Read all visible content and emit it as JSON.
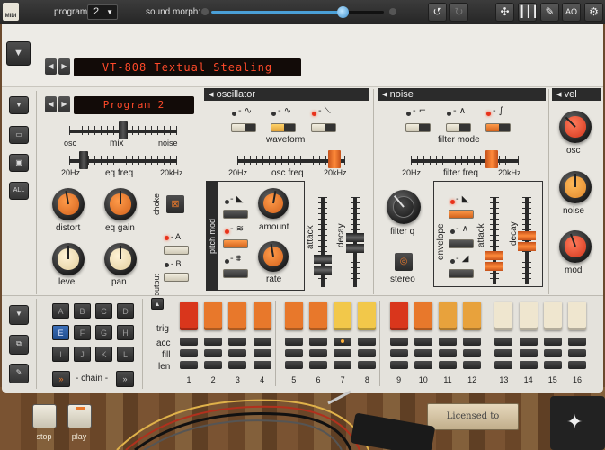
{
  "topbar": {
    "midi_badge": "MIDI",
    "program_label": "program:",
    "program_value": "2",
    "morph_label": "sound morph:",
    "morph_value": 0.76,
    "buttons": [
      "undo-icon",
      "redo-icon",
      "grid-icon",
      "mixer-icon",
      "edit-icon",
      "ab-icon",
      "gear-icon"
    ],
    "ab_label": "Aʘ"
  },
  "header": {
    "preset_name": "VT-808 Textual Stealing",
    "program_name": "Program 2"
  },
  "side": {
    "all_label": "ALL"
  },
  "left_section": {
    "mix": {
      "label": "mix",
      "left": "osc",
      "right": "noise",
      "value": 0.5
    },
    "eq_freq": {
      "label": "eq freq",
      "left": "20Hz",
      "right": "20kHz",
      "value": 0.1
    },
    "knobs": [
      {
        "label": "distort",
        "value": 0.55
      },
      {
        "label": "eq gain",
        "value": 0.5
      },
      {
        "label": "level",
        "value": 0.5
      },
      {
        "label": "pan",
        "value": 0.5
      }
    ],
    "choke_label": "choke",
    "output_label": "output",
    "output_a": "- A",
    "output_b": "- B"
  },
  "oscillator": {
    "title": "oscillator",
    "waveform_label": "waveform",
    "osc_freq": {
      "label": "osc freq",
      "left": "20Hz",
      "right": "20kHz",
      "value": 0.95
    },
    "pitch_mod_label": "pitch mod",
    "amount_label": "amount",
    "rate_label": "rate",
    "attack_label": "attack",
    "decay_label": "decay"
  },
  "noise": {
    "title": "noise",
    "filter_mode_label": "filter mode",
    "filter_freq": {
      "label": "filter freq",
      "left": "20Hz",
      "right": "20kHz",
      "value": 0.78
    },
    "filter_q_label": "filter q",
    "stereo_label": "stereo",
    "envelope_label": "envelope",
    "attack_label": "attack",
    "decay_label": "decay"
  },
  "vel": {
    "title": "vel",
    "knobs": [
      {
        "label": "osc",
        "value": 0.35
      },
      {
        "label": "noise",
        "value": 0.5
      },
      {
        "label": "mod",
        "value": 0.4
      }
    ]
  },
  "sequencer": {
    "pads": [
      "A",
      "B",
      "C",
      "D",
      "E",
      "F",
      "G",
      "H",
      "I",
      "J",
      "K",
      "L"
    ],
    "selected_pad": "E",
    "chain_label": "- chain -",
    "row_labels": [
      "trig",
      "acc",
      "fill",
      "len"
    ],
    "steps": [
      "1",
      "2",
      "3",
      "4",
      "5",
      "6",
      "7",
      "8",
      "9",
      "10",
      "11",
      "12",
      "13",
      "14",
      "15",
      "16"
    ],
    "trig_colors": [
      "#d9361c",
      "#e8782b",
      "#e8782b",
      "#e8782b",
      "#e8782b",
      "#e8782b",
      "#f2c84a",
      "#f2c84a",
      "#d9361c",
      "#e8782b",
      "#e8a23c",
      "#e8a23c",
      "#efe6cf",
      "#efe6cf",
      "#efe6cf",
      "#efe6cf"
    ]
  },
  "bottom": {
    "stop_label": "stop",
    "play_label": "play",
    "license_label": "Licensed to"
  },
  "colors": {
    "accent": "#e8782b",
    "lcd": "#ff4a2a",
    "morph": "#4a9fd6"
  }
}
